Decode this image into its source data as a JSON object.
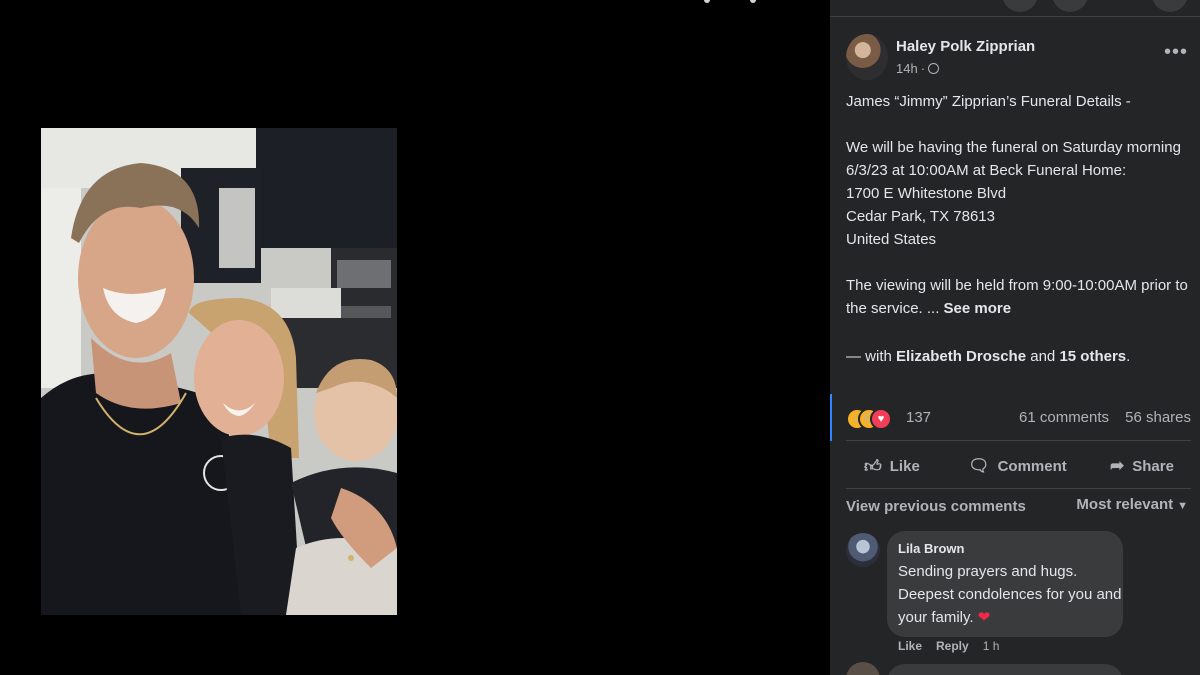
{
  "post": {
    "author": "Haley Polk Zipprian",
    "time": "14h",
    "time_separator": "·",
    "privacy_icon": "globe-icon",
    "more_icon": "more-horizontal-icon",
    "text": {
      "line1": "James “Jimmy” Zipprian’s Funeral Details -",
      "para2": "We will be having the funeral on Saturday morning 6/3/23 at 10:00AM at Beck Funeral Home:",
      "address1": "1700 E Whitestone Blvd",
      "address2": "Cedar Park, TX 78613",
      "address3": "United States",
      "para3": "The viewing will be held from 9:00-10:00AM prior to the service. ...",
      "see_more": "See more"
    },
    "with": {
      "prefix": "— with",
      "person": "Elizabeth Drosche",
      "conj": "and",
      "others": "15 others",
      "suffix": "."
    }
  },
  "stats": {
    "reaction_icons": [
      "care-icon",
      "sad-icon",
      "love-icon"
    ],
    "reactions": "137",
    "comments": "61 comments",
    "shares": "56 shares"
  },
  "actions": {
    "like": "Like",
    "comment": "Comment",
    "share": "Share"
  },
  "comments_header": {
    "view_previous": "View previous comments",
    "sort": "Most relevant"
  },
  "comments": [
    {
      "name": "Lila Brown",
      "text": "Sending prayers and hugs. Deepest condolences for you and your family.",
      "emoji": "heart-icon",
      "like": "Like",
      "reply": "Reply",
      "time": "1 h"
    }
  ],
  "colors": {
    "panel_bg": "#242526",
    "bubble_bg": "#3a3b3c",
    "text_primary": "#e4e6eb",
    "text_secondary": "#b0b3b8",
    "accent": "#2d88ff",
    "heart": "#f02849"
  }
}
